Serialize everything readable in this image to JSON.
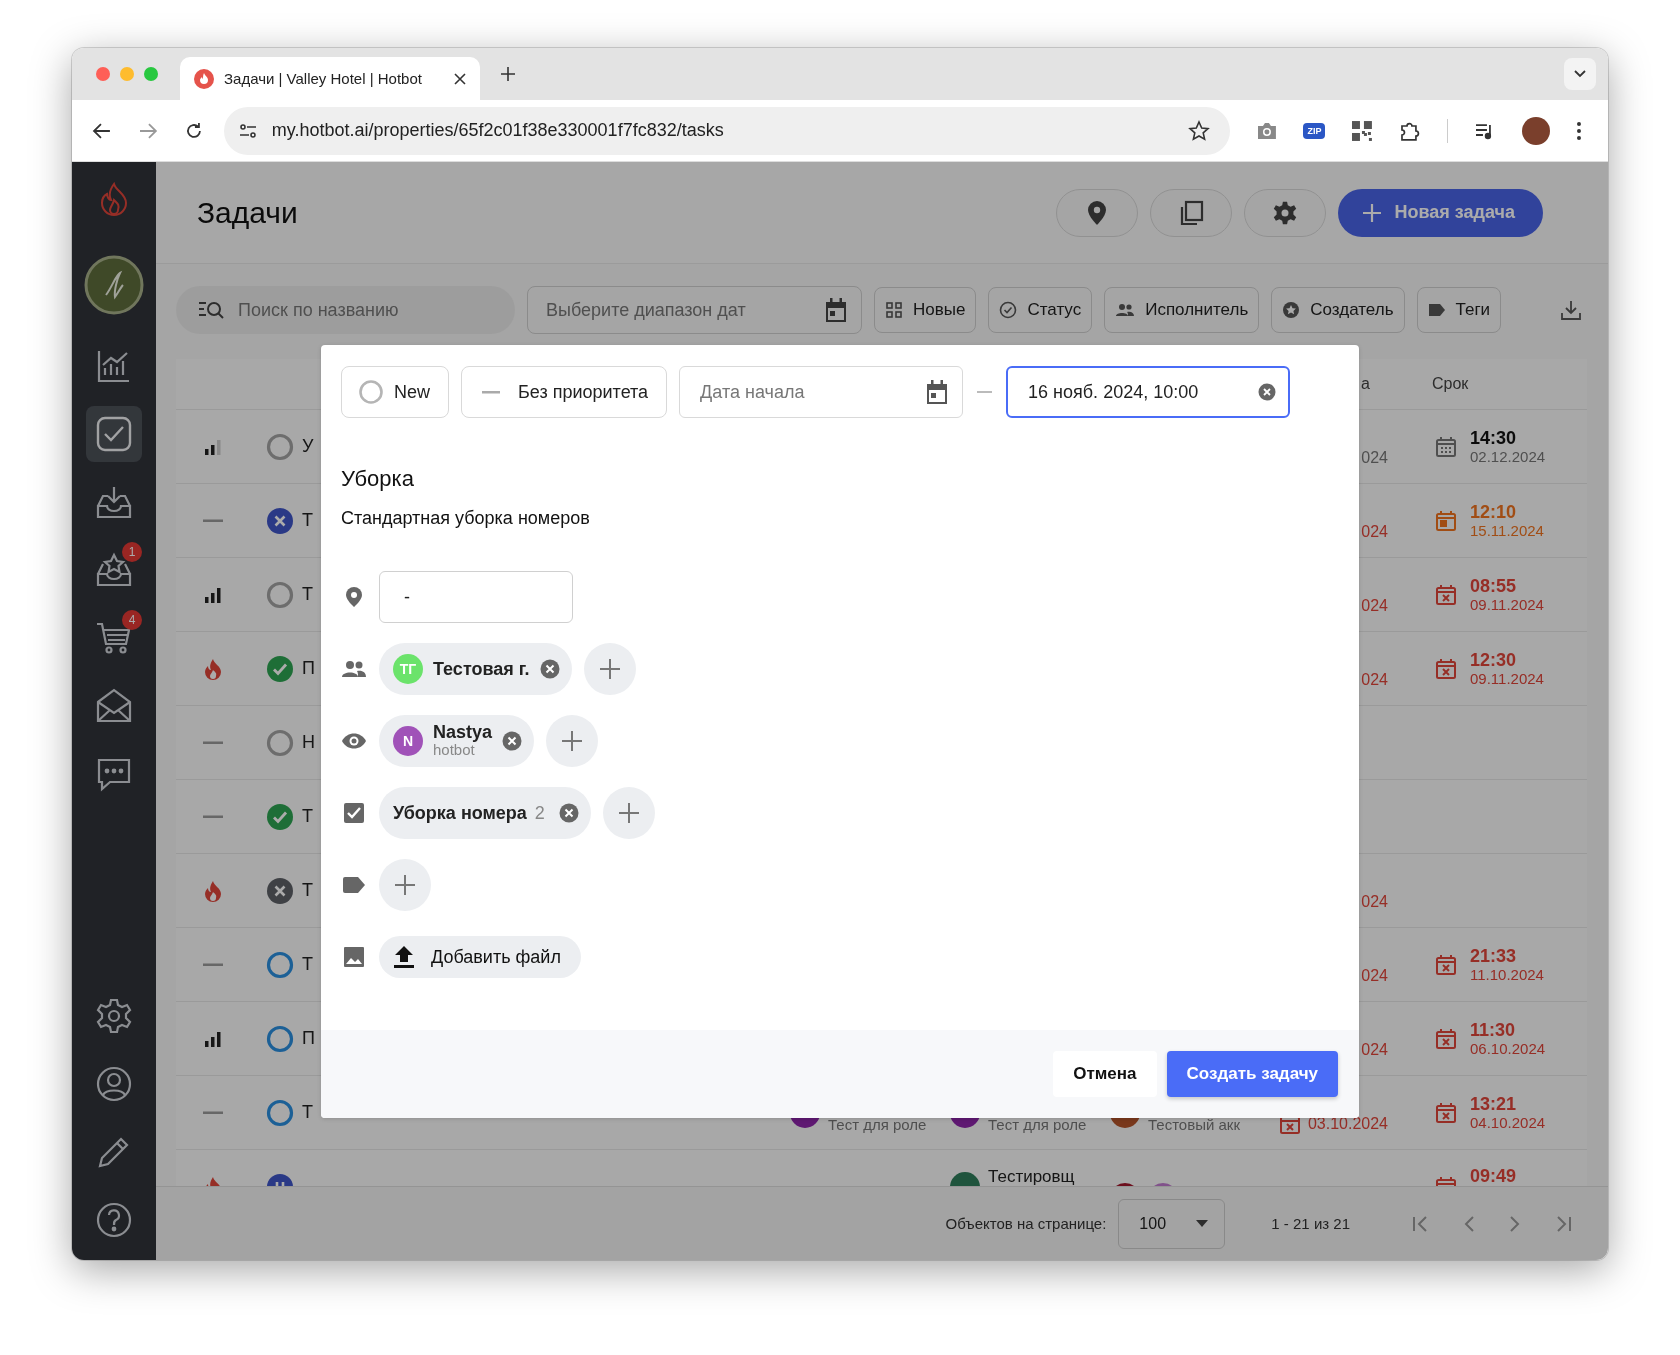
{
  "browser": {
    "tab_title": "Задачи | Valley Hotel | Hotbot",
    "url": "my.hotbot.ai/properties/65f2c01f38e330001f7fc832/tasks",
    "extension_label": "ZIP"
  },
  "sidebar": {
    "top_items": [
      {
        "kind": "chart",
        "selected": false
      },
      {
        "kind": "tasks",
        "selected": true
      },
      {
        "kind": "inbox",
        "selected": false
      },
      {
        "kind": "reviews",
        "selected": false,
        "badge": "1"
      },
      {
        "kind": "cart",
        "selected": false,
        "badge": "4"
      },
      {
        "kind": "mail",
        "selected": false
      },
      {
        "kind": "chat",
        "selected": false
      }
    ],
    "bottom_items": [
      {
        "kind": "settings",
        "selected": false
      },
      {
        "kind": "profile",
        "selected": false
      },
      {
        "kind": "pencil",
        "selected": false
      },
      {
        "kind": "help",
        "selected": false
      }
    ]
  },
  "header": {
    "title": "Задачи",
    "new_button": "Новая задача"
  },
  "filters": {
    "search_placeholder": "Поиск по названию",
    "date_placeholder": "Выберите диапазон дат",
    "chips": [
      {
        "kind": "grid",
        "label": "Новые"
      },
      {
        "kind": "status",
        "label": "Статус"
      },
      {
        "kind": "people",
        "label": "Исполнитель"
      },
      {
        "kind": "star",
        "label": "Создатель"
      },
      {
        "kind": "tag",
        "label": "Теги"
      }
    ]
  },
  "table": {
    "columns": [
      "а",
      "Срок"
    ],
    "rows": [
      {
        "priority": {
          "kind": "medium"
        },
        "status": {
          "kind": "new"
        },
        "title": "У",
        "created": {
          "text": "024",
          "overdue": false
        },
        "due": {
          "time": "14:30",
          "date": "02.12.2024",
          "kind": "upcoming"
        }
      },
      {
        "priority": {
          "kind": "none"
        },
        "status": {
          "kind": "declined"
        },
        "title": "Т",
        "created": {
          "text": "024",
          "overdue": true
        },
        "due": {
          "time": "12:10",
          "date": "15.11.2024",
          "kind": "today"
        }
      },
      {
        "priority": {
          "kind": "high"
        },
        "status": {
          "kind": "new"
        },
        "title": "Т",
        "created": {
          "text": "024",
          "overdue": true
        },
        "due": {
          "time": "08:55",
          "date": "09.11.2024",
          "kind": "overdue"
        }
      },
      {
        "priority": {
          "kind": "urgent"
        },
        "status": {
          "kind": "done"
        },
        "title": "П",
        "created": {
          "text": "024",
          "overdue": true
        },
        "due": {
          "time": "12:30",
          "date": "09.11.2024",
          "kind": "overdue"
        }
      },
      {
        "priority": {
          "kind": "none"
        },
        "status": {
          "kind": "new"
        },
        "title": "Н"
      },
      {
        "priority": {
          "kind": "none"
        },
        "status": {
          "kind": "done"
        },
        "title": "Т"
      },
      {
        "priority": {
          "kind": "urgent"
        },
        "status": {
          "kind": "cancelled"
        },
        "title": "Т",
        "created": {
          "text": "024",
          "overdue": true
        }
      },
      {
        "priority": {
          "kind": "none"
        },
        "status": {
          "kind": "in_progress"
        },
        "title": "Т",
        "created": {
          "text": "024",
          "overdue": true
        },
        "due": {
          "time": "21:33",
          "date": "11.10.2024",
          "kind": "overdue"
        }
      },
      {
        "priority": {
          "kind": "high"
        },
        "status": {
          "kind": "in_progress"
        },
        "title": "П",
        "created": {
          "text": "024",
          "overdue": true
        },
        "due": {
          "time": "11:30",
          "date": "06.10.2024",
          "kind": "overdue"
        }
      },
      {
        "priority": {
          "kind": "none"
        },
        "status": {
          "kind": "in_progress"
        },
        "title": "Т",
        "cells": [
          {
            "kind": "role",
            "text": "Тест для роле",
            "color": "#5f1872"
          },
          {
            "kind": "role",
            "text": "Тест для роле",
            "color": "#5f1872"
          },
          {
            "kind": "role",
            "text": "Тестовый акк",
            "color": "#79381c"
          }
        ],
        "created": {
          "text": "03.10.2024",
          "overdue": true,
          "icon": true
        },
        "due": {
          "time": "13:21",
          "date": "04.10.2024",
          "kind": "overdue"
        }
      },
      {
        "priority": {
          "kind": "urgent"
        },
        "status": {
          "kind": "paused"
        },
        "cells": [
          {
            "kind": "empty"
          },
          {
            "kind": "name",
            "text": "Тестировщ",
            "color": "#1f543d"
          },
          {
            "kind": "avatars",
            "avatars": [
              {
                "color": "#6d0f1d"
              },
              {
                "color": "#81528b"
              }
            ]
          }
        ],
        "due": {
          "time": "09:49",
          "kind": "overdue"
        }
      }
    ]
  },
  "pagination": {
    "per_page_label": "Объектов на странице:",
    "per_page": "100",
    "range": "1 - 21 из 21"
  },
  "modal": {
    "status": {
      "label": "New"
    },
    "priority": {
      "label": "Без приоритета"
    },
    "start_date": {
      "placeholder": "Дата начала"
    },
    "end_date": {
      "value": "16 нояб. 2024, 10:00",
      "focused": true
    },
    "title": "Уборка",
    "description": "Стандартная уборка номеров",
    "location": {
      "value": "-"
    },
    "assignees": [
      {
        "initials": "ТГ",
        "name": "Тестовая г.",
        "color": "#6be36b"
      }
    ],
    "watchers": [
      {
        "initials": "N",
        "name": "Nastya",
        "subtitle": "hotbot",
        "color": "#a052b8"
      }
    ],
    "checklists": [
      {
        "name": "Уборка номера",
        "count": "2"
      }
    ],
    "attach_button": "Добавить файл",
    "cancel_button": "Отмена",
    "submit_button": "Создать задачу"
  }
}
